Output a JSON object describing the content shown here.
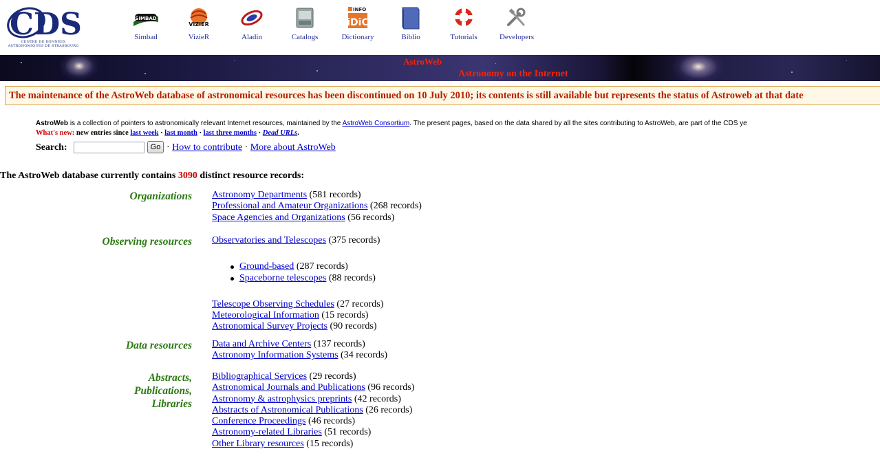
{
  "logo": {
    "text": "CDS",
    "tagline_line1": "CENTRE DE DONNÉES",
    "tagline_line2": "ASTRONOMIQUES DE STRASBOURG"
  },
  "nav": [
    {
      "label": "Simbad",
      "icon": "simbad-icon"
    },
    {
      "label": "VizieR",
      "icon": "vizier-icon"
    },
    {
      "label": "Aladin",
      "icon": "aladin-icon"
    },
    {
      "label": "Catalogs",
      "icon": "catalogs-icon"
    },
    {
      "label": "Dictionary",
      "icon": "dictionary-icon"
    },
    {
      "label": "Biblio",
      "icon": "biblio-icon"
    },
    {
      "label": "Tutorials",
      "icon": "tutorials-icon"
    },
    {
      "label": "Developers",
      "icon": "developers-icon"
    }
  ],
  "nav_icon_text": {
    "simbad": "SIMBAD",
    "vizier": "VIZIER",
    "dictionary_top": "INFO",
    "dictionary_main": "iDiC"
  },
  "banner": {
    "title": "AstroWeb",
    "subtitle": "Astronomy on the Internet"
  },
  "notice": "The maintenance of the AstroWeb database of astronomical resources has been discontinued on 10 July 2010; its contents is still available but represents the status of Astroweb at that date",
  "intro": {
    "name": "AstroWeb",
    "text_before_link": " is a collection of pointers to astronomically relevant Internet resources, maintained by the ",
    "consortium_link": "AstroWeb Consortium",
    "text_after_link": ". The present pages, based on the data shared by all the sites contributing to AstroWeb, are part of the CDS ye"
  },
  "whatsnew": {
    "label": "What's new:",
    "text": " new entries since ",
    "last_week": "last week",
    "last_month": "last month",
    "last_three_months": "last three months",
    "dead_urls": "Dead URLs",
    "sep": " · ",
    "end": "."
  },
  "search": {
    "label": "Search:",
    "value": "",
    "go_label": "Go",
    "how_to_contribute": "How to contribute",
    "more_about": "More about AstroWeb",
    "sep": " · "
  },
  "heading": {
    "before": "The AstroWeb database currently contains ",
    "count": "3090",
    "after": " distinct resource records:"
  },
  "categories": {
    "organizations": {
      "label": "Organizations",
      "items": [
        {
          "link": "Astronomy Departments",
          "count": " (581 records)"
        },
        {
          "link": "Professional and Amateur Organizations",
          "count": " (268 records)"
        },
        {
          "link": "Space Agencies and Organizations",
          "count": " (56 records)"
        }
      ]
    },
    "observing": {
      "label": "Observing resources",
      "main": {
        "link": "Observatories and Telescopes",
        "count": " (375 records)"
      },
      "sub": [
        {
          "link": "Ground-based",
          "count": " (287 records)"
        },
        {
          "link": "Spaceborne telescopes",
          "count": " (88 records)"
        }
      ],
      "items": [
        {
          "link": "Telescope Observing Schedules",
          "count": " (27 records)"
        },
        {
          "link": "Meteorological Information",
          "count": " (15 records)"
        },
        {
          "link": "Astronomical Survey Projects",
          "count": " (90 records)"
        }
      ]
    },
    "data": {
      "label": "Data resources",
      "items": [
        {
          "link": "Data and Archive Centers",
          "count": " (137 records)"
        },
        {
          "link": "Astronomy Information Systems",
          "count": " (34 records)"
        }
      ]
    },
    "abstracts": {
      "label_line1": "Abstracts,",
      "label_line2": "Publications,",
      "label_line3": "Libraries",
      "items": [
        {
          "link": "Bibliographical Services",
          "count": " (29 records)"
        },
        {
          "link": "Astronomical Journals and Publications",
          "count": " (96 records)"
        },
        {
          "link": "Astronomy & astrophysics preprints",
          "count": " (42 records)"
        },
        {
          "link": "Abstracts of Astronomical Publications",
          "count": " (26 records)"
        },
        {
          "link": "Conference Proceedings",
          "count": " (46 records)"
        },
        {
          "link": "Astronomy-related Libraries",
          "count": " (51 records)"
        },
        {
          "link": "Other Library resources",
          "count": " (15 records)"
        }
      ]
    }
  },
  "colors": {
    "link": "#0000cc",
    "category_label": "#2a7a12",
    "notice_text": "#b31f00",
    "banner_text": "#ff2200",
    "count_red": "#cc0000"
  }
}
